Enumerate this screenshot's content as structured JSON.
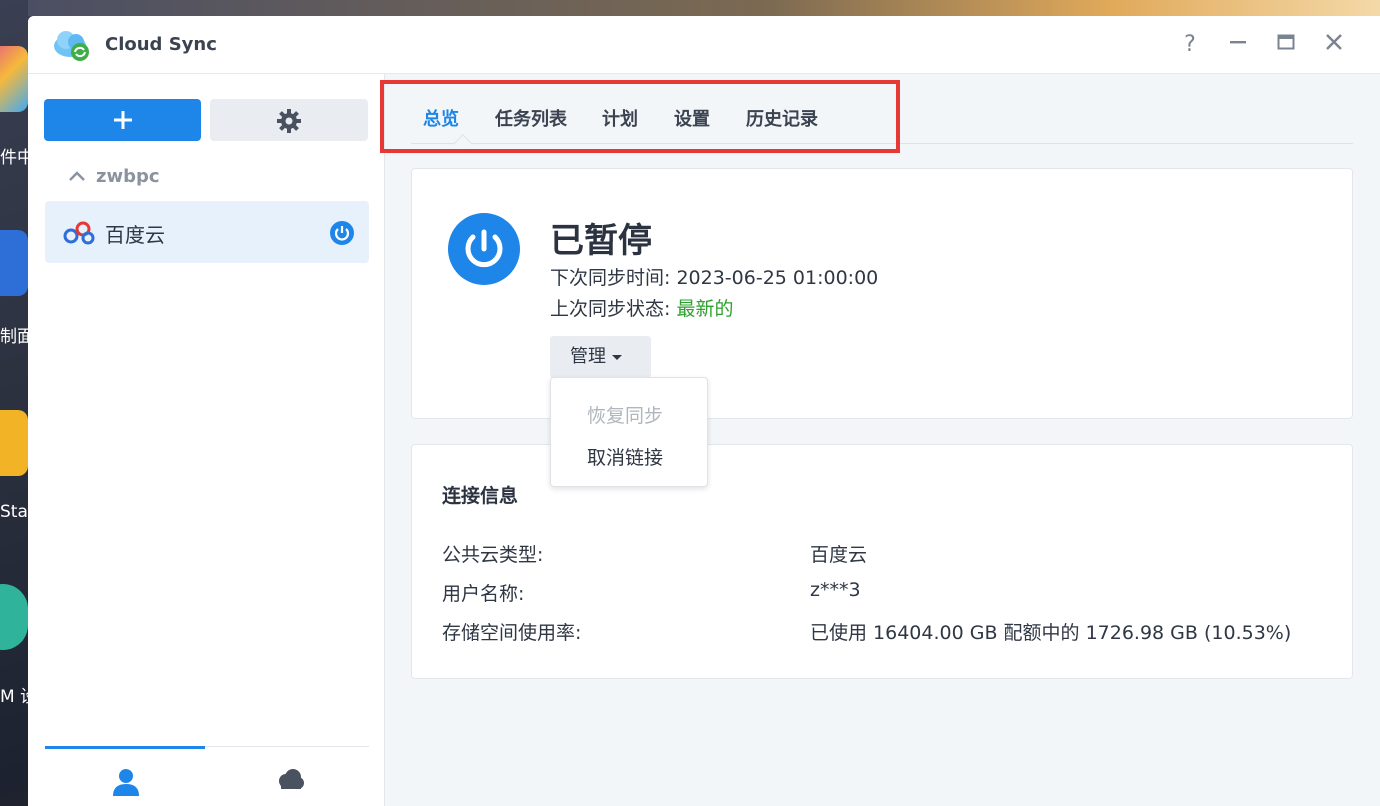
{
  "desktop": {
    "labels": [
      "件中",
      "制面",
      "Sta",
      "M 设"
    ]
  },
  "window": {
    "title": "Cloud Sync",
    "controls": {
      "help": "?",
      "minimize": "—",
      "maximize": "▭",
      "close": "✕"
    }
  },
  "sidebar": {
    "add_label": "+",
    "group": {
      "name": "zwbpc",
      "expanded": true
    },
    "connections": [
      {
        "label": "百度云",
        "status": "paused",
        "selected": true
      }
    ],
    "bottom_tabs": [
      {
        "icon": "user-icon",
        "active": true
      },
      {
        "icon": "cloud-icon",
        "active": false
      }
    ]
  },
  "tabs": [
    {
      "label": "总览",
      "active": true
    },
    {
      "label": "任务列表",
      "active": false
    },
    {
      "label": "计划",
      "active": false
    },
    {
      "label": "设置",
      "active": false
    },
    {
      "label": "历史记录",
      "active": false
    }
  ],
  "status": {
    "title": "已暂停",
    "next_sync_label": "下次同步时间:",
    "next_sync_value": "2023-06-25 01:00:00",
    "last_status_label": "上次同步状态:",
    "last_status_value": "最新的",
    "manage_label": "管理"
  },
  "manage_menu": [
    {
      "label": "恢复同步",
      "enabled": false
    },
    {
      "label": "取消链接",
      "enabled": true
    }
  ],
  "connection_info": {
    "title": "连接信息",
    "rows": [
      {
        "label": "公共云类型:",
        "value": "百度云"
      },
      {
        "label": "用户名称:",
        "value": "z***3"
      },
      {
        "label": "存储空间使用率:",
        "value": "已使用 16404.00 GB 配额中的 1726.98 GB (10.53%)"
      }
    ]
  },
  "colors": {
    "accent": "#1d86e8",
    "success": "#2ea22e",
    "highlight": "#e53935"
  }
}
